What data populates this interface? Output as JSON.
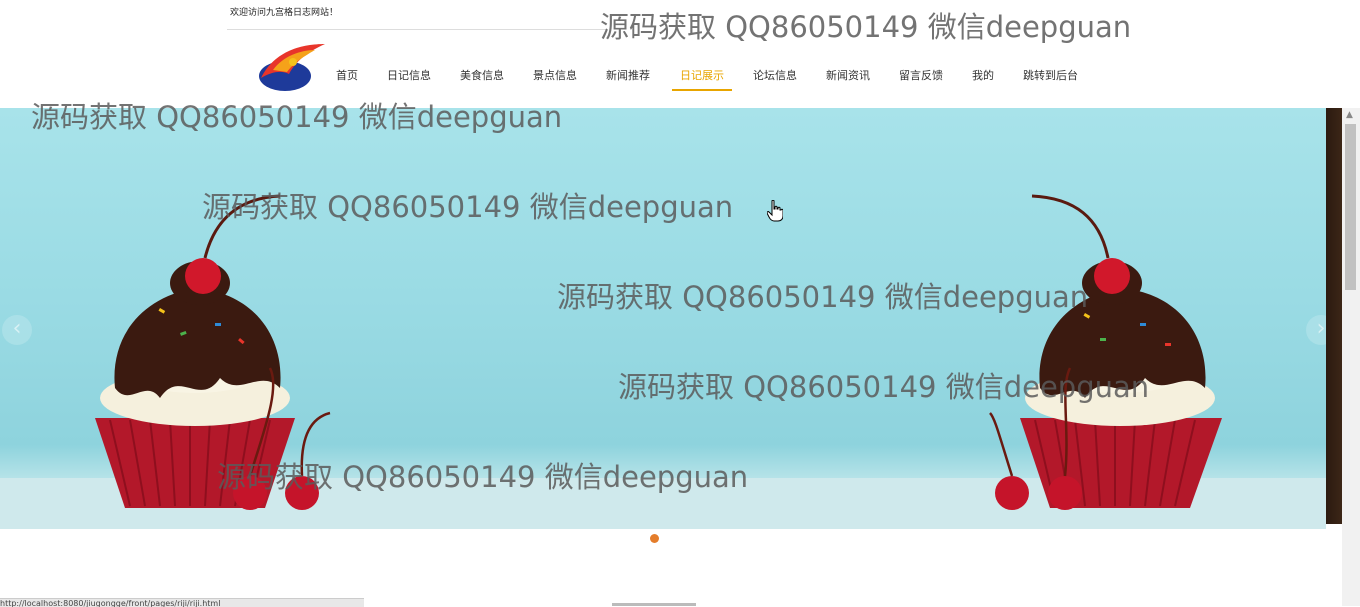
{
  "header": {
    "welcome_text": "欢迎访问九宫格日志网站！"
  },
  "nav": {
    "items": [
      {
        "label": "首页"
      },
      {
        "label": "日记信息"
      },
      {
        "label": "美食信息"
      },
      {
        "label": "景点信息"
      },
      {
        "label": "新闻推荐"
      },
      {
        "label": "日记展示",
        "active": true
      },
      {
        "label": "论坛信息"
      },
      {
        "label": "新闻资讯"
      },
      {
        "label": "留言反馈"
      },
      {
        "label": "我的"
      },
      {
        "label": "跳转到后台"
      }
    ]
  },
  "carousel": {
    "prev_label": "‹",
    "next_label": "›",
    "active_dot_color": "#e47d2b"
  },
  "watermark": {
    "text": "源码获取 QQ86050149 微信deepguan"
  },
  "status_bar": {
    "url_text": "http://localhost:8080/jiugongge/front/pages/riji/riji.html"
  },
  "colors": {
    "nav_active": "#e8a500",
    "banner_bg": "#a8e3ea"
  }
}
